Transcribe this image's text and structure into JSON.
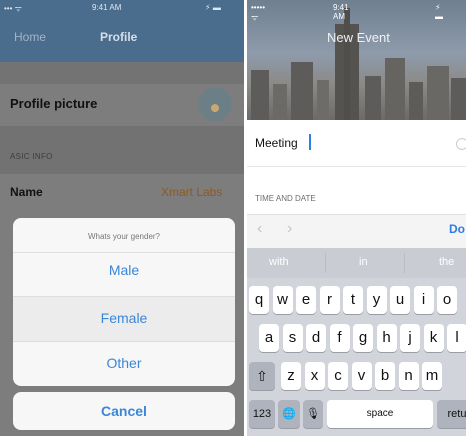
{
  "left_screen": {
    "status": {
      "signal": "••• ᯤ",
      "time": "9:41 AM",
      "battery": "⚡ ▬"
    },
    "navbar": {
      "back": "Home",
      "title": "Profile"
    },
    "profile_picture_label": "Profile picture",
    "section_header": "ASIC INFO",
    "name_label": "Name",
    "name_value": "Xmart Labs",
    "action_sheet": {
      "title": "Whats your gender?",
      "options": [
        "Male",
        "Female",
        "Other"
      ],
      "cancel": "Cancel"
    }
  },
  "right_screen": {
    "status": {
      "signal": "••••• ᯤ",
      "time": "9:41 AM",
      "battery": "⚡ ▬"
    },
    "title": "New Event",
    "title_field_value": "Meeting",
    "section_header": "TIME AND DATE",
    "toolbar": {
      "prev": "‹",
      "next": "›",
      "done": "Do"
    },
    "keyboard": {
      "predictions": [
        "with",
        "in",
        "the"
      ],
      "row1": [
        "q",
        "w",
        "e",
        "r",
        "t",
        "y",
        "u",
        "i",
        "o"
      ],
      "row2": [
        "a",
        "s",
        "d",
        "f",
        "g",
        "h",
        "j",
        "k",
        "l"
      ],
      "row3": [
        "z",
        "x",
        "c",
        "v",
        "b",
        "n",
        "m"
      ],
      "shift": "⇧",
      "numbers": "123",
      "globe": "🌐",
      "mic": "🎙",
      "space": "space",
      "return": "retu"
    }
  }
}
